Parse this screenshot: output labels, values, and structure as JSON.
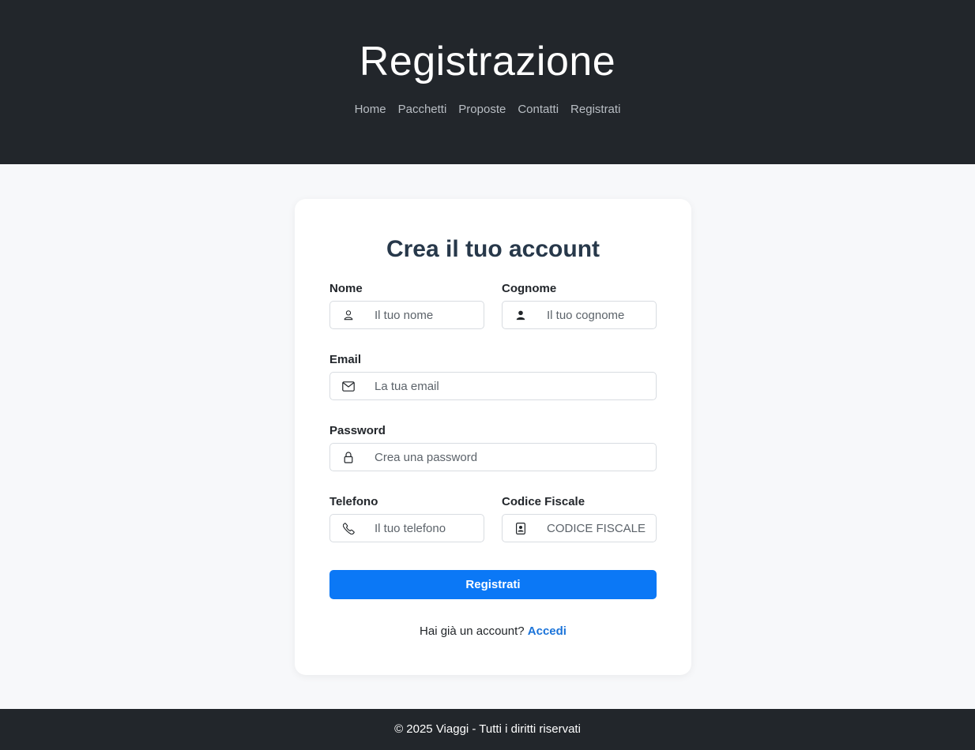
{
  "header": {
    "title": "Registrazione",
    "nav": [
      "Home",
      "Pacchetti",
      "Proposte",
      "Contatti",
      "Registrati"
    ]
  },
  "form": {
    "heading": "Crea il tuo account",
    "fields": {
      "nome": {
        "label": "Nome",
        "placeholder": "Il tuo nome",
        "value": "",
        "icon": "user-outline-icon"
      },
      "cognome": {
        "label": "Cognome",
        "placeholder": "Il tuo cognome",
        "value": "",
        "icon": "user-filled-icon"
      },
      "email": {
        "label": "Email",
        "placeholder": "La tua email",
        "value": "",
        "icon": "envelope-icon"
      },
      "password": {
        "label": "Password",
        "placeholder": "Crea una password",
        "value": "",
        "icon": "lock-icon"
      },
      "telefono": {
        "label": "Telefono",
        "placeholder": "Il tuo telefono",
        "value": "",
        "icon": "phone-icon"
      },
      "codice_fiscale": {
        "label": "Codice Fiscale",
        "placeholder": "CODICE FISCALE",
        "value": "",
        "icon": "id-badge-icon"
      }
    },
    "submit_label": "Registrati",
    "login_prompt": "Hai già un account?",
    "login_link": "Accedi"
  },
  "footer": {
    "text": "© 2025 Viaggi - Tutti i diritti riservati"
  },
  "colors": {
    "header_bg": "#22262b",
    "page_bg": "#f7f8fa",
    "primary": "#0b78f6",
    "link": "#1a73d9",
    "heading": "#27384a"
  }
}
